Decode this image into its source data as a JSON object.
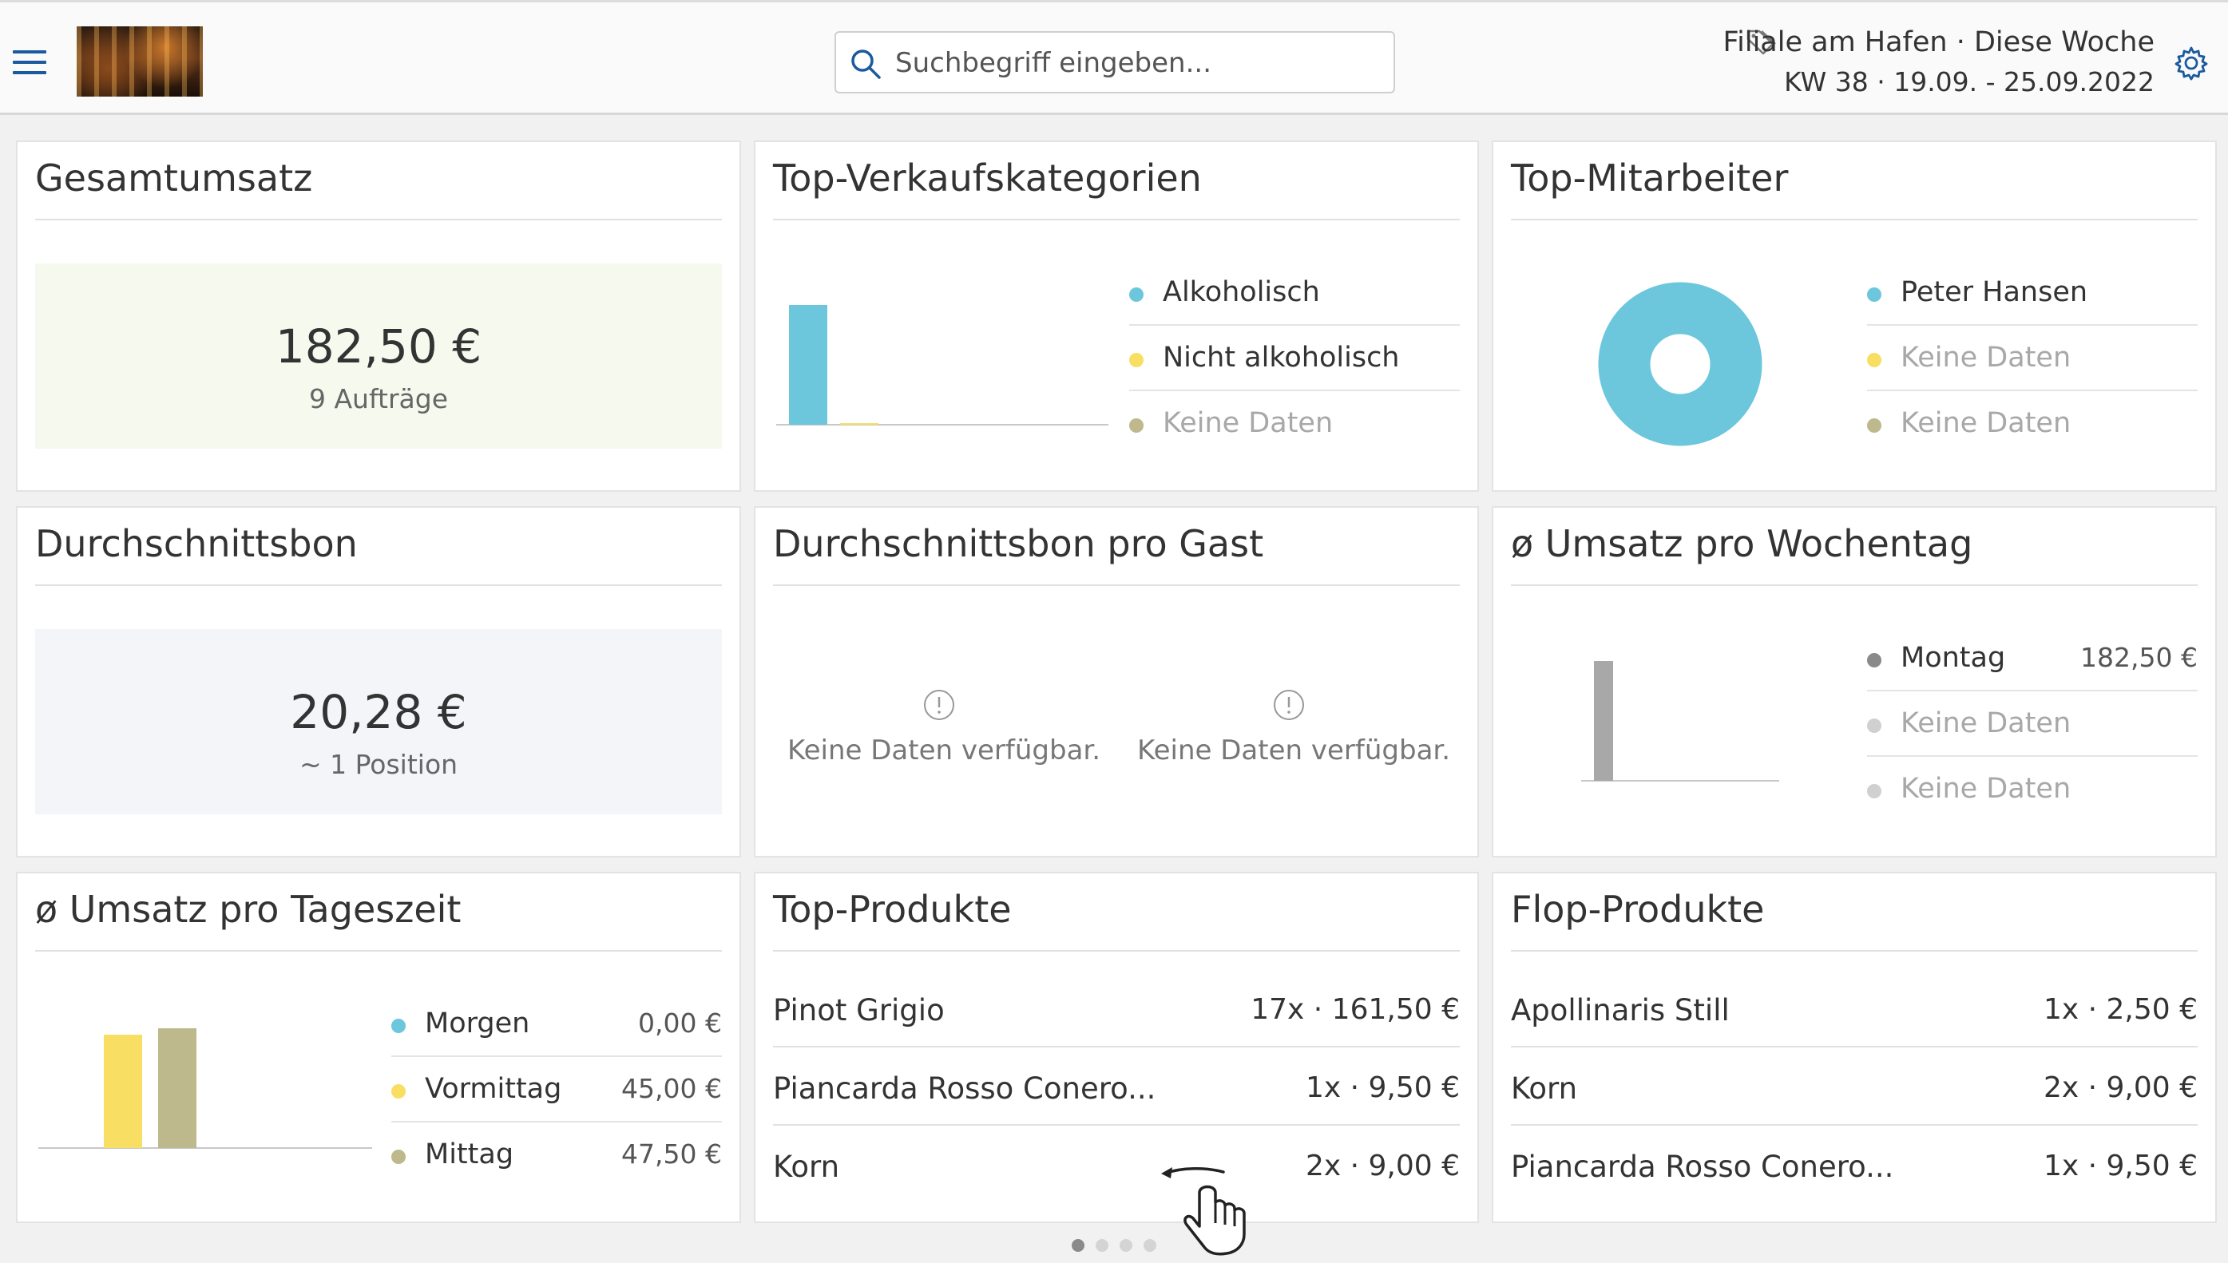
{
  "header": {
    "search_placeholder": "Suchbegriff eingeben...",
    "location": "Filiale am Hafen · Diese Woche",
    "period": "KW 38 · 19.09. - 25.09.2022"
  },
  "colors": {
    "teal": "#6cc7dc",
    "yellow": "#f8de63",
    "khaki": "#bdb98c",
    "gray_bar": "#a8a8a8",
    "gray_dot": "#8a8a8a",
    "light_dot": "#d0d0d0",
    "accent": "#1a5a9e"
  },
  "cards": {
    "gesamtumsatz": {
      "title": "Gesamtumsatz",
      "value": "182,50 €",
      "sub": "9 Aufträge"
    },
    "top_kategorien": {
      "title": "Top-Verkaufskategorien",
      "legend": [
        {
          "label": "Alkoholisch",
          "color": "#6cc7dc"
        },
        {
          "label": "Nicht alkoholisch",
          "color": "#f8de63"
        },
        {
          "label": "Keine Daten",
          "color": "#bdb98c"
        }
      ]
    },
    "top_mitarbeiter": {
      "title": "Top-Mitarbeiter",
      "legend": [
        {
          "label": "Peter Hansen",
          "color": "#6cc7dc"
        },
        {
          "label": "Keine Daten",
          "color": "#f8de63"
        },
        {
          "label": "Keine Daten",
          "color": "#bdb98c"
        }
      ]
    },
    "durchschnittsbon": {
      "title": "Durchschnittsbon",
      "value": "20,28 €",
      "sub": "~ 1 Position"
    },
    "bon_pro_gast": {
      "title": "Durchschnittsbon pro Gast",
      "nodata_left": "Keine Daten verfügbar.",
      "nodata_right": "Keine Daten verfügbar."
    },
    "umsatz_wochentag": {
      "title": "ø Umsatz pro Wochentag",
      "legend": [
        {
          "label": "Montag",
          "value": "182,50 €",
          "color": "#8a8a8a"
        },
        {
          "label": "Keine Daten",
          "value": "",
          "color": "#d0d0d0"
        },
        {
          "label": "Keine Daten",
          "value": "",
          "color": "#d0d0d0"
        }
      ]
    },
    "umsatz_tageszeit": {
      "title": "ø Umsatz pro Tageszeit",
      "legend": [
        {
          "label": "Morgen",
          "value": "0,00 €",
          "color": "#6cc7dc"
        },
        {
          "label": "Vormittag",
          "value": "45,00 €",
          "color": "#f8de63"
        },
        {
          "label": "Mittag",
          "value": "47,50 €",
          "color": "#bdb98c"
        }
      ]
    },
    "top_produkte": {
      "title": "Top-Produkte",
      "rows": [
        {
          "name": "Pinot Grigio",
          "value": "17x · 161,50 €"
        },
        {
          "name": "Piancarda Rosso Conero...",
          "value": "1x · 9,50 €"
        },
        {
          "name": "Korn",
          "value": "2x · 9,00 €"
        }
      ]
    },
    "flop_produkte": {
      "title": "Flop-Produkte",
      "rows": [
        {
          "name": "Apollinaris Still",
          "value": "1x · 2,50 €"
        },
        {
          "name": "Korn",
          "value": "2x · 9,00 €"
        },
        {
          "name": "Piancarda Rosso Conero...",
          "value": "1x · 9,50 €"
        }
      ]
    }
  },
  "chart_data": [
    {
      "type": "bar",
      "title": "Top-Verkaufskategorien",
      "categories": [
        "Alkoholisch",
        "Nicht alkoholisch",
        "Keine Daten"
      ],
      "values": [
        151,
        1,
        0
      ],
      "ylim": [
        0,
        170
      ]
    },
    {
      "type": "pie",
      "title": "Top-Mitarbeiter",
      "categories": [
        "Peter Hansen",
        "Keine Daten",
        "Keine Daten"
      ],
      "values": [
        182.5,
        0,
        0
      ]
    },
    {
      "type": "bar",
      "title": "ø Umsatz pro Wochentag",
      "categories": [
        "Montag",
        "Keine Daten",
        "Keine Daten"
      ],
      "values": [
        182.5,
        0,
        0
      ],
      "ylim": [
        0,
        220
      ]
    },
    {
      "type": "bar",
      "title": "ø Umsatz pro Tageszeit",
      "categories": [
        "Morgen",
        "Vormittag",
        "Mittag"
      ],
      "values": [
        0,
        45,
        47.5
      ],
      "ylim": [
        0,
        55
      ]
    }
  ],
  "pager": {
    "total": 4,
    "active": 0
  }
}
